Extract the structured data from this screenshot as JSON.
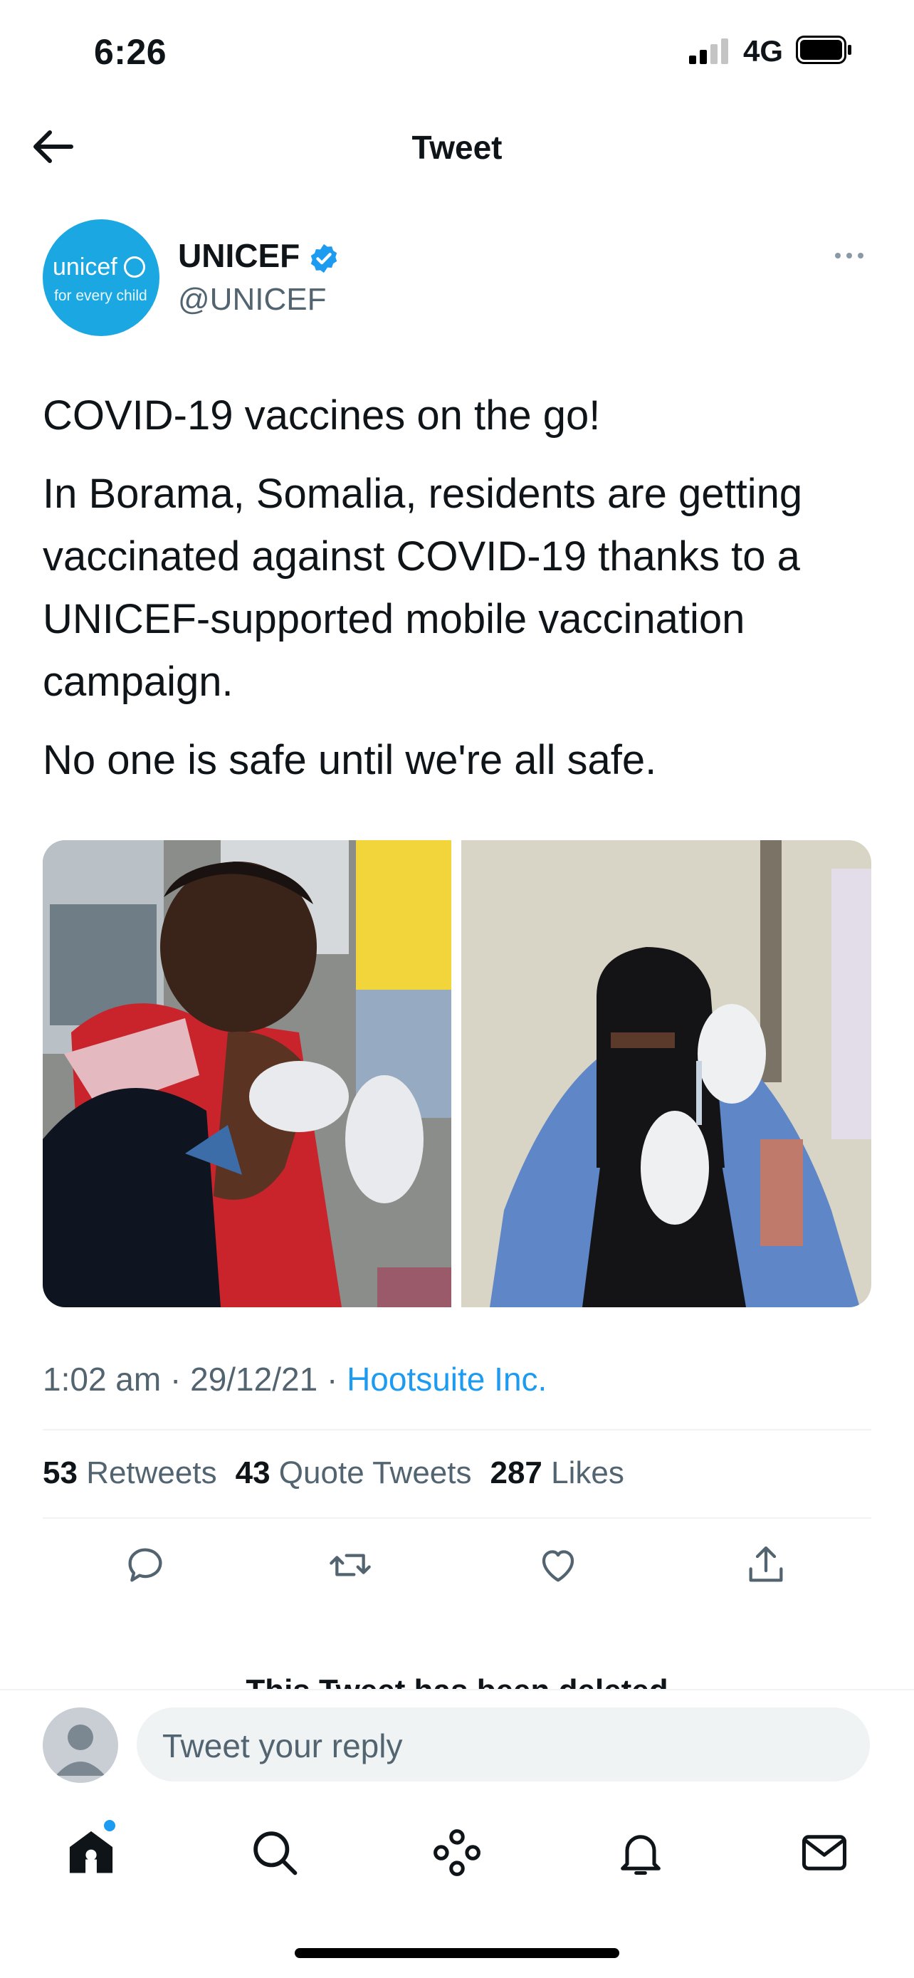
{
  "status_bar": {
    "time": "6:26",
    "network": "4G"
  },
  "nav": {
    "title": "Tweet"
  },
  "author": {
    "name": "UNICEF",
    "handle": "@UNICEF",
    "avatar_text": "unicef",
    "avatar_tagline": "for every child"
  },
  "tweet": {
    "paragraphs": [
      "COVID-19 vaccines on the go!",
      "In Borama, Somalia, residents are getting vaccinated against COVID-19 thanks to a UNICEF-supported mobile vaccination campaign.",
      "No one is safe until we're all safe."
    ],
    "time": "1:02 am",
    "date": "29/12/21",
    "source": "Hootsuite Inc."
  },
  "stats": {
    "retweets_count": "53",
    "retweets_label": "Retweets",
    "quotes_count": "43",
    "quotes_label": "Quote Tweets",
    "likes_count": "287",
    "likes_label": "Likes"
  },
  "deleted_notice": "This Tweet has been deleted",
  "reply": {
    "placeholder": "Tweet your reply"
  },
  "colors": {
    "accent": "#1d9bf0",
    "unicef_blue": "#1ba7e1",
    "muted": "#536471"
  }
}
